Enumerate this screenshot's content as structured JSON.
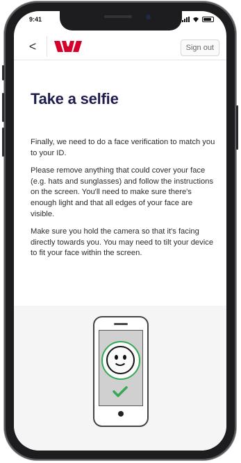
{
  "status_bar": {
    "time": "9:41"
  },
  "header": {
    "back_label": "<",
    "sign_out_label": "Sign out",
    "brand_color": "#d5002b"
  },
  "page": {
    "title": "Take a selfie",
    "paragraphs": [
      "Finally, we need to do a face verification to match you to your ID.",
      "Please remove anything that could cover your face (e.g. hats and sunglasses) and follow the instructions on the screen. You'll need to make sure there's enough light and that all edges of your face are visible.",
      "Make sure you hold the camera so that it's facing directly towards you. You may need to tilt your device to fit your face within the screen."
    ]
  },
  "illustration": {
    "icons": [
      "phone-icon",
      "smiley-face-icon",
      "checkmark-icon"
    ],
    "accent_color": "#35a853"
  }
}
